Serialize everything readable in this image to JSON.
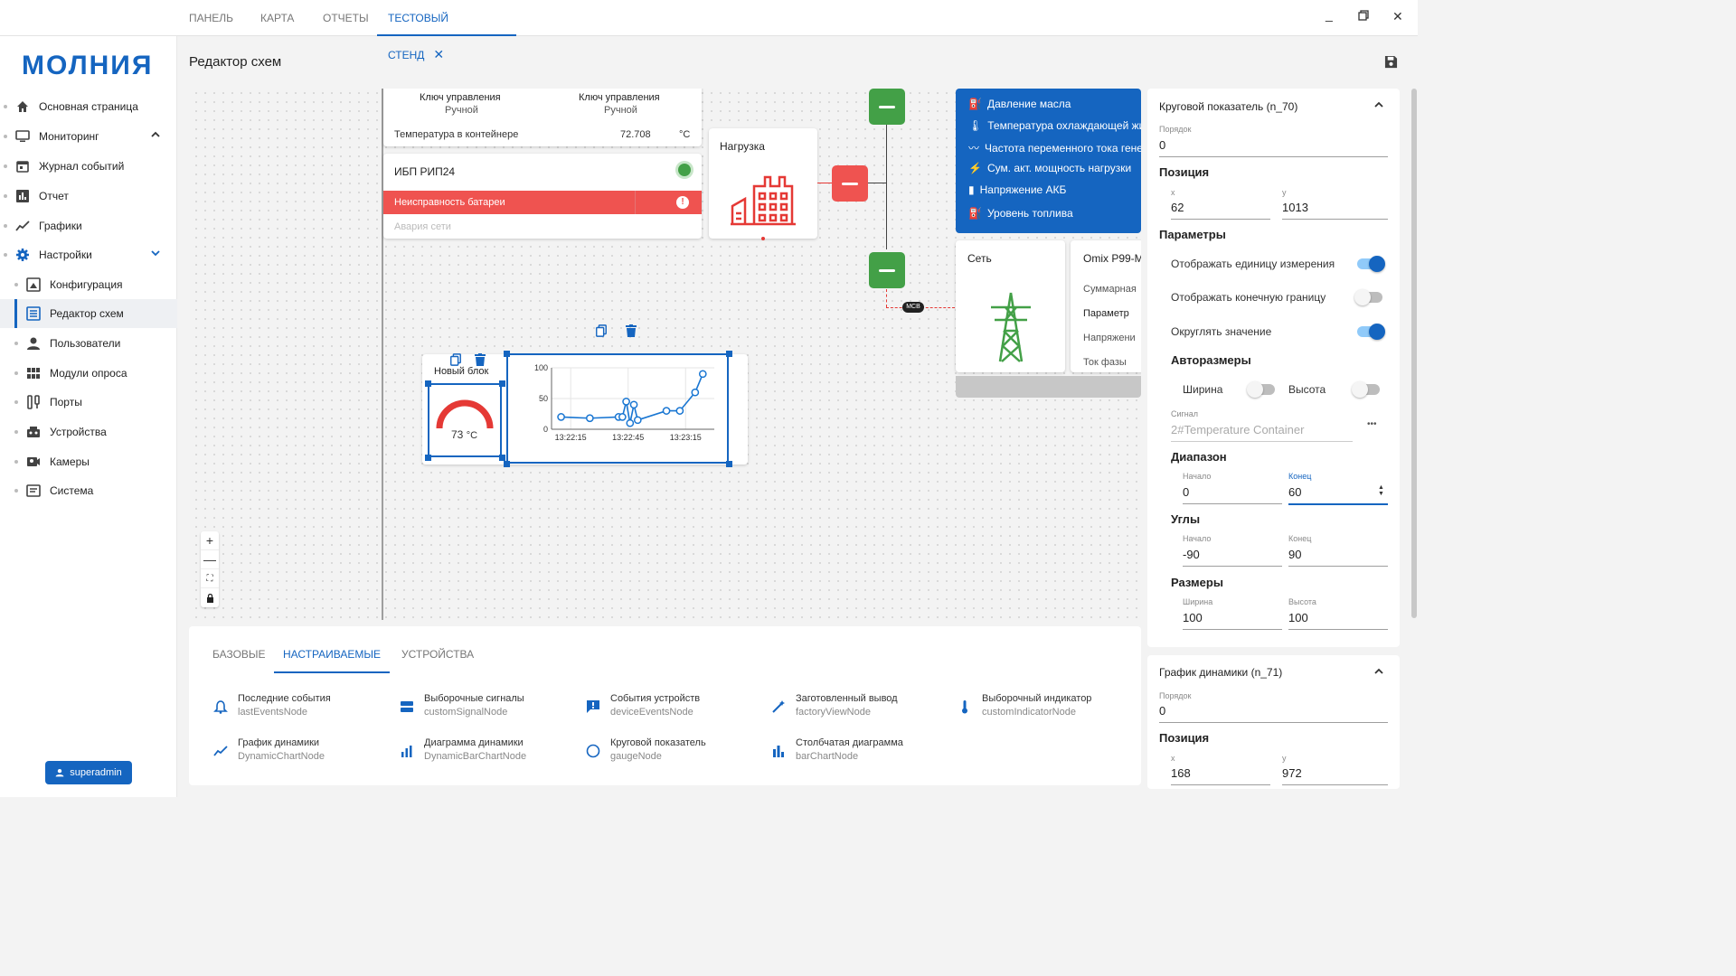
{
  "tabs": [
    {
      "label": "ПАНЕЛЬ"
    },
    {
      "label": "КАРТА"
    },
    {
      "label": "ОТЧЕТЫ"
    },
    {
      "label": "ТЕСТОВЫЙ СТЕНД"
    }
  ],
  "app": {
    "logo": "МОЛНИЯ"
  },
  "sidebar": {
    "items": [
      {
        "label": "Основная страница",
        "icon": "home-icon"
      },
      {
        "label": "Мониторинг",
        "icon": "monitor-icon"
      },
      {
        "label": "Журнал событий",
        "icon": "calendar-icon"
      },
      {
        "label": "Отчет",
        "icon": "report-icon"
      },
      {
        "label": "Графики",
        "icon": "chart-line-icon"
      },
      {
        "label": "Настройки",
        "icon": "gear-icon"
      },
      {
        "label": "Конфигурация",
        "icon": "config-icon"
      },
      {
        "label": "Редактор схем",
        "icon": "schema-icon"
      },
      {
        "label": "Пользователи",
        "icon": "user-icon"
      },
      {
        "label": "Модули опроса",
        "icon": "grid-icon"
      },
      {
        "label": "Порты",
        "icon": "port-icon"
      },
      {
        "label": "Устройства",
        "icon": "device-icon"
      },
      {
        "label": "Камеры",
        "icon": "camera-icon"
      },
      {
        "label": "Система",
        "icon": "system-icon"
      }
    ],
    "user": "superadmin"
  },
  "page": {
    "title": "Редактор схем"
  },
  "canvas": {
    "ctrl_key_1_label": "Ключ управления",
    "ctrl_key_1_value": "Ручной",
    "ctrl_key_2_label": "Ключ управления",
    "ctrl_key_2_value": "Ручной",
    "temp_label": "Температура в контейнере",
    "temp_value": "72.708",
    "temp_unit": "°C",
    "ups_title": "ИБП РИП24",
    "ups_fault": "Неисправность батареи",
    "ups_alarm": "Авария сети",
    "load_title": "Нагрузка",
    "mcb_label": "MCB",
    "grid_title": "Сеть",
    "omix_title": "Omix P99-M",
    "omix_rows": [
      "Суммарная",
      "Параметр",
      "Напряжени",
      "Ток фазы"
    ],
    "blue_rows": [
      "Давление масла",
      "Температура охлаждающей жи",
      "Частота переменного тока гене",
      "Сум. акт. мощность нагрузки",
      "Напряжение АКБ",
      "Уровень топлива"
    ],
    "new_block_title": "Новый блок",
    "gauge_value": "73",
    "gauge_unit": "°C",
    "accent": "#1565c0",
    "status_green": "#43a047",
    "status_red": "#ef5350"
  },
  "chart_data": {
    "type": "line",
    "x": [
      "13:22:10",
      "13:22:25",
      "13:22:40",
      "13:22:42",
      "13:22:44",
      "13:22:46",
      "13:22:48",
      "13:22:50",
      "13:23:05",
      "13:23:12",
      "13:23:20",
      "13:23:24"
    ],
    "values": [
      20,
      18,
      20,
      20,
      45,
      10,
      40,
      15,
      30,
      30,
      60,
      90
    ],
    "xticks": [
      "13:22:15",
      "13:22:45",
      "13:23:15"
    ],
    "yticks": [
      "100",
      "50",
      "0"
    ],
    "ylim": [
      0,
      100
    ]
  },
  "palette": {
    "tabs": [
      "БАЗОВЫЕ",
      "НАСТРАИВАЕМЫЕ",
      "УСТРОЙСТВА"
    ],
    "items": [
      {
        "name": "Последние события",
        "id": "lastEventsNode",
        "icon": "bell-icon"
      },
      {
        "name": "Выборочные сигналы",
        "id": "customSignalNode",
        "icon": "signals-icon"
      },
      {
        "name": "События устройств",
        "id": "deviceEventsNode",
        "icon": "alert-icon"
      },
      {
        "name": "Заготовленный вывод",
        "id": "factoryViewNode",
        "icon": "wand-icon"
      },
      {
        "name": "Выборочный индикатор",
        "id": "customIndicatorNode",
        "icon": "thermometer-icon"
      },
      {
        "name": "График динамики",
        "id": "DynamicChartNode",
        "icon": "chart-line-icon"
      },
      {
        "name": "Диаграмма динамики",
        "id": "DynamicBarChartNode",
        "icon": "bar-chart-icon"
      },
      {
        "name": "Круговой показатель",
        "id": "gaugeNode",
        "icon": "circle-icon"
      },
      {
        "name": "Столбчатая диаграмма",
        "id": "barChartNode",
        "icon": "bar-chart-icon"
      }
    ]
  },
  "props": {
    "title": "Круговой показатель (n_70)",
    "order_label": "Порядок",
    "order_value": "0",
    "position_title": "Позиция",
    "x_label": "x",
    "x_value": "62",
    "y_label": "y",
    "y_value": "1013",
    "params_title": "Параметры",
    "show_unit": "Отображать единицу измерения",
    "show_limit": "Отображать конечную границу",
    "round_value": "Округлять значение",
    "autosize_title": "Авторазмеры",
    "width_label": "Ширина",
    "height_label": "Высота",
    "signal_label": "Сигнал",
    "signal_value": "2#Temperature Container",
    "signal_more": "•••",
    "range_title": "Диапазон",
    "range_start_label": "Начало",
    "range_start_value": "0",
    "range_end_label": "Конец",
    "range_end_value": "60",
    "angles_title": "Углы",
    "angle_start_label": "Начало",
    "angle_start_value": "-90",
    "angle_end_label": "Конец",
    "angle_end_value": "90",
    "sizes_title": "Размеры",
    "size_w_label": "Ширина",
    "size_w_value": "100",
    "size_h_label": "Высота",
    "size_h_value": "100"
  },
  "props2": {
    "title": "График динамики (n_71)",
    "order_label": "Порядок",
    "order_value": "0",
    "position_title": "Позиция",
    "x_label": "x",
    "x_value": "168",
    "y_label": "y",
    "y_value": "972"
  }
}
